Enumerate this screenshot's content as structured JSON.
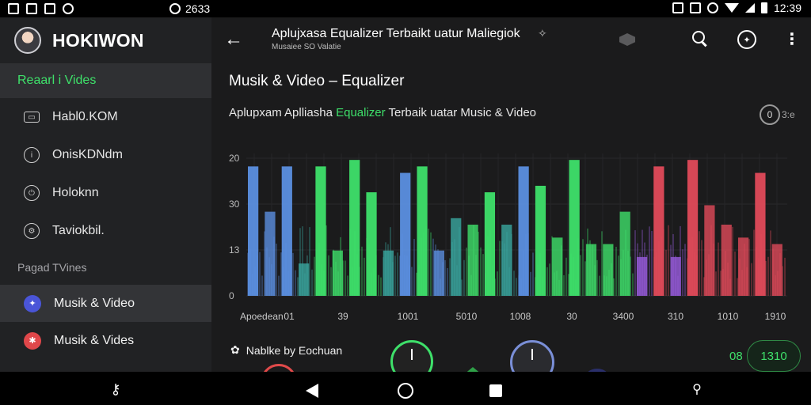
{
  "status_bar": {
    "center_text": "2633",
    "time": "12:39"
  },
  "drawer": {
    "brand": "HOKIWON",
    "active_section": "Reaarl i Vides",
    "items": [
      {
        "label": "Habl0.KOM",
        "icon": "media-icon"
      },
      {
        "label": "OnisKDNdm",
        "icon": "info-icon"
      },
      {
        "label": "Holoknn",
        "icon": "power-icon"
      },
      {
        "label": "Taviokbil.",
        "icon": "settings-icon"
      }
    ],
    "subheader": "Pagad TVines",
    "pages": [
      {
        "label": "Musik & Video",
        "color": "#4a55d8",
        "selected": true
      },
      {
        "label": "Musik & Vides",
        "color": "#e0474a",
        "selected": false
      }
    ]
  },
  "appbar": {
    "title": "Aplujxasa Equalizer Terbaikt uatur Maliegiok",
    "subtitle": "Musaiee SO Valatie"
  },
  "main": {
    "section_title": "Musik & Video – Equalizer",
    "intro_prefix": "Aplupxam  Aplliasha ",
    "intro_highlight": "Equalizer",
    "intro_suffix": " Terbaik  uatar Music & Video",
    "toggle_value": "0",
    "toggle_label": "3:e",
    "bottom_label": "Nablke by Eochuan",
    "value_a": "08",
    "value_b": "1310"
  },
  "colors": {
    "accent_green": "#3ee06a",
    "blue": "#5b8fe0",
    "red": "#e04a5a",
    "purple": "#8a5ce0"
  },
  "chart_data": {
    "type": "bar",
    "yticks": [
      "20",
      "30",
      "13",
      "0"
    ],
    "xticks": [
      "Apoedean",
      "01",
      "39",
      "1001",
      "5010",
      "1008",
      "30",
      "3400",
      "310",
      "1010",
      "1910"
    ],
    "bars": [
      {
        "v": 20,
        "c": "blue"
      },
      {
        "v": 13,
        "c": "blue"
      },
      {
        "v": 20,
        "c": "blue"
      },
      {
        "v": 5,
        "c": "teal"
      },
      {
        "v": 20,
        "c": "green"
      },
      {
        "v": 7,
        "c": "green"
      },
      {
        "v": 21,
        "c": "green"
      },
      {
        "v": 16,
        "c": "green"
      },
      {
        "v": 7,
        "c": "teal"
      },
      {
        "v": 19,
        "c": "blue"
      },
      {
        "v": 20,
        "c": "green"
      },
      {
        "v": 7,
        "c": "blue"
      },
      {
        "v": 12,
        "c": "teal"
      },
      {
        "v": 11,
        "c": "green"
      },
      {
        "v": 16,
        "c": "green"
      },
      {
        "v": 11,
        "c": "teal"
      },
      {
        "v": 20,
        "c": "blue"
      },
      {
        "v": 17,
        "c": "green"
      },
      {
        "v": 9,
        "c": "green"
      },
      {
        "v": 21,
        "c": "green"
      },
      {
        "v": 8,
        "c": "green"
      },
      {
        "v": 8,
        "c": "green"
      },
      {
        "v": 13,
        "c": "green"
      },
      {
        "v": 6,
        "c": "purple"
      },
      {
        "v": 20,
        "c": "red"
      },
      {
        "v": 6,
        "c": "purple"
      },
      {
        "v": 21,
        "c": "red"
      },
      {
        "v": 14,
        "c": "red"
      },
      {
        "v": 11,
        "c": "red"
      },
      {
        "v": 9,
        "c": "red"
      },
      {
        "v": 19,
        "c": "red"
      },
      {
        "v": 8,
        "c": "red"
      }
    ]
  }
}
